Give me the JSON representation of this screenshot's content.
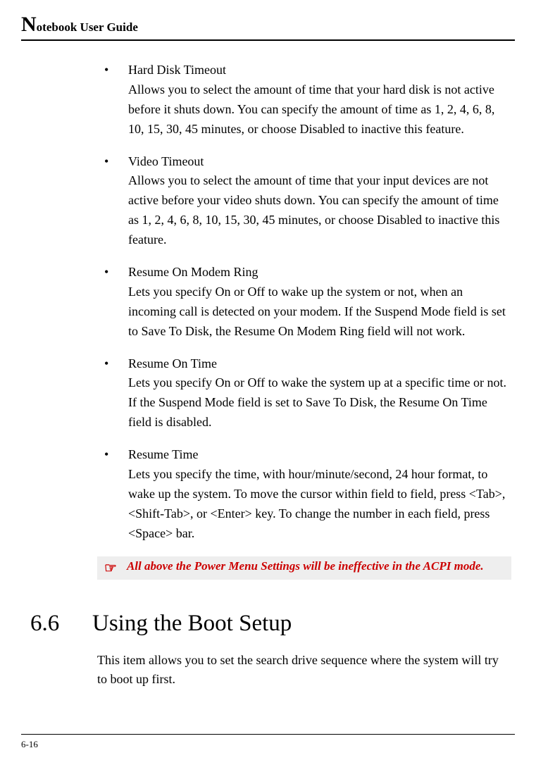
{
  "header": {
    "dropcap": "N",
    "rest": "otebook User Guide"
  },
  "bullets": [
    {
      "title": "Hard Disk Timeout",
      "body": "Allows you to select the amount of time that your hard disk is not active before it shuts down. You can specify the amount of time as 1, 2, 4, 6, 8, 10, 15, 30, 45 minutes, or choose Disabled to inactive this feature."
    },
    {
      "title": "Video Timeout",
      "body": "Allows you to select the amount of time that your input devices are not active before your video shuts down. You can specify the amount of time as 1, 2, 4, 6, 8, 10, 15, 30, 45 minutes, or choose Disabled to inactive this feature."
    },
    {
      "title": "Resume On Modem Ring",
      "body": "Lets you specify On or Off to wake up the system or not, when an incoming call is detected on your modem. If the Suspend Mode field is set to Save To Disk, the Resume On Modem Ring field will not work."
    },
    {
      "title": "Resume On Time",
      "body": "Lets you specify On or Off to wake the system up at a specific time or not. If the Suspend Mode field is set to Save To Disk, the Resume On Time field is disabled."
    },
    {
      "title": "Resume Time",
      "body": "Lets you specify the time, with hour/minute/second, 24 hour format, to wake up the system. To move the cursor within field to field, press <Tab>, <Shift-Tab>, or <Enter> key. To change the number in each field, press <Space> bar."
    }
  ],
  "note": {
    "icon": "☞",
    "text": "All above the Power Menu Settings will be ineffective in the ACPI mode."
  },
  "section": {
    "number": "6.6",
    "title": "Using the Boot Setup",
    "body": "This item allows you to set the search drive sequence where the system will try to boot up first."
  },
  "footer": {
    "page": "6-16"
  }
}
